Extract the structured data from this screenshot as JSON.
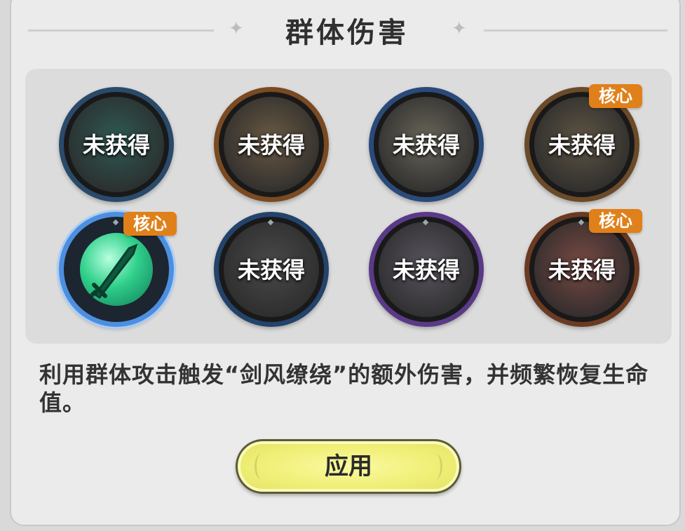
{
  "panel": {
    "title": "群体伤害",
    "title_decor": "✦"
  },
  "skills": [
    {
      "status": "未获得",
      "core_badge": "",
      "icon": "web-slash-icon",
      "ring_color": "#2a4a6a",
      "art_color": "#2f5a55"
    },
    {
      "status": "未获得",
      "core_badge": "",
      "icon": "burst-explosion-icon",
      "ring_color": "#7a4a22",
      "art_color": "#6a5a44"
    },
    {
      "status": "未获得",
      "core_badge": "",
      "icon": "claw-strike-icon",
      "ring_color": "#2a4a7a",
      "art_color": "#6a665a"
    },
    {
      "status": "未获得",
      "core_badge": "核心",
      "icon": "whirlwind-icon",
      "ring_color": "#6a4a28",
      "art_color": "#5e5444"
    },
    {
      "status": "",
      "core_badge": "核心",
      "icon": "sword-wind-icon",
      "ring_color": "#4d8fdf",
      "art_color": "#2fcf8a"
    },
    {
      "status": "未获得",
      "core_badge": "",
      "icon": "arrows-up-icon",
      "ring_color": "#23436a",
      "art_color": "#4a4a4a"
    },
    {
      "status": "未获得",
      "core_badge": "",
      "icon": "hexagon-shield-icon",
      "ring_color": "#5a3a86",
      "art_color": "#5a5560"
    },
    {
      "status": "未获得",
      "core_badge": "核心",
      "icon": "red-storm-icon",
      "ring_color": "#6a3a22",
      "art_color": "#7a4a44"
    }
  ],
  "description": "利用群体攻击触发“剑风缭绕”的额外伤害，并频繁恢复生命值。",
  "apply_button": {
    "label": "应用"
  }
}
